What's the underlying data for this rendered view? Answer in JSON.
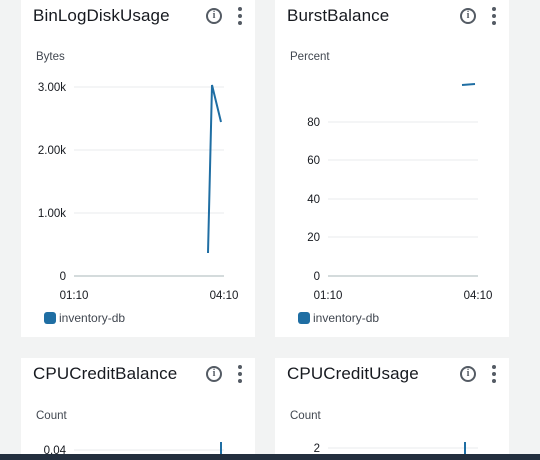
{
  "accent_color": "#1f6ea3",
  "cards": [
    {
      "title": "BinLogDiskUsage",
      "unit": "Bytes",
      "legend": "inventory-db",
      "y_ticks": [
        "3.00k",
        "2.00k",
        "1.00k",
        "0"
      ],
      "x_ticks": [
        "01:10",
        "04:10"
      ]
    },
    {
      "title": "BurstBalance",
      "unit": "Percent",
      "legend": "inventory-db",
      "y_ticks": [
        "80",
        "60",
        "40",
        "20",
        "0"
      ],
      "x_ticks": [
        "01:10",
        "04:10"
      ]
    },
    {
      "title": "CPUCreditBalance",
      "unit": "Count",
      "y_ticks": [
        "0.04"
      ]
    },
    {
      "title": "CPUCreditUsage",
      "unit": "Count",
      "y_ticks": [
        "2"
      ]
    }
  ],
  "icons": {
    "info": "info-icon",
    "more": "more-actions-icon"
  },
  "chart_data": [
    {
      "type": "line",
      "title": "BinLogDiskUsage",
      "ylabel": "Bytes",
      "x": [
        "01:10",
        "04:10"
      ],
      "ylim": [
        0,
        3000
      ],
      "series": [
        {
          "name": "inventory-db",
          "x": [
            3.65,
            3.75,
            4.0
          ],
          "y": [
            350,
            3000,
            2450
          ]
        }
      ]
    },
    {
      "type": "line",
      "title": "BurstBalance",
      "ylabel": "Percent",
      "x": [
        "01:10",
        "04:10"
      ],
      "ylim": [
        0,
        100
      ],
      "series": [
        {
          "name": "inventory-db",
          "x": [
            3.8,
            4.0
          ],
          "y": [
            99.5,
            100
          ]
        }
      ]
    }
  ]
}
